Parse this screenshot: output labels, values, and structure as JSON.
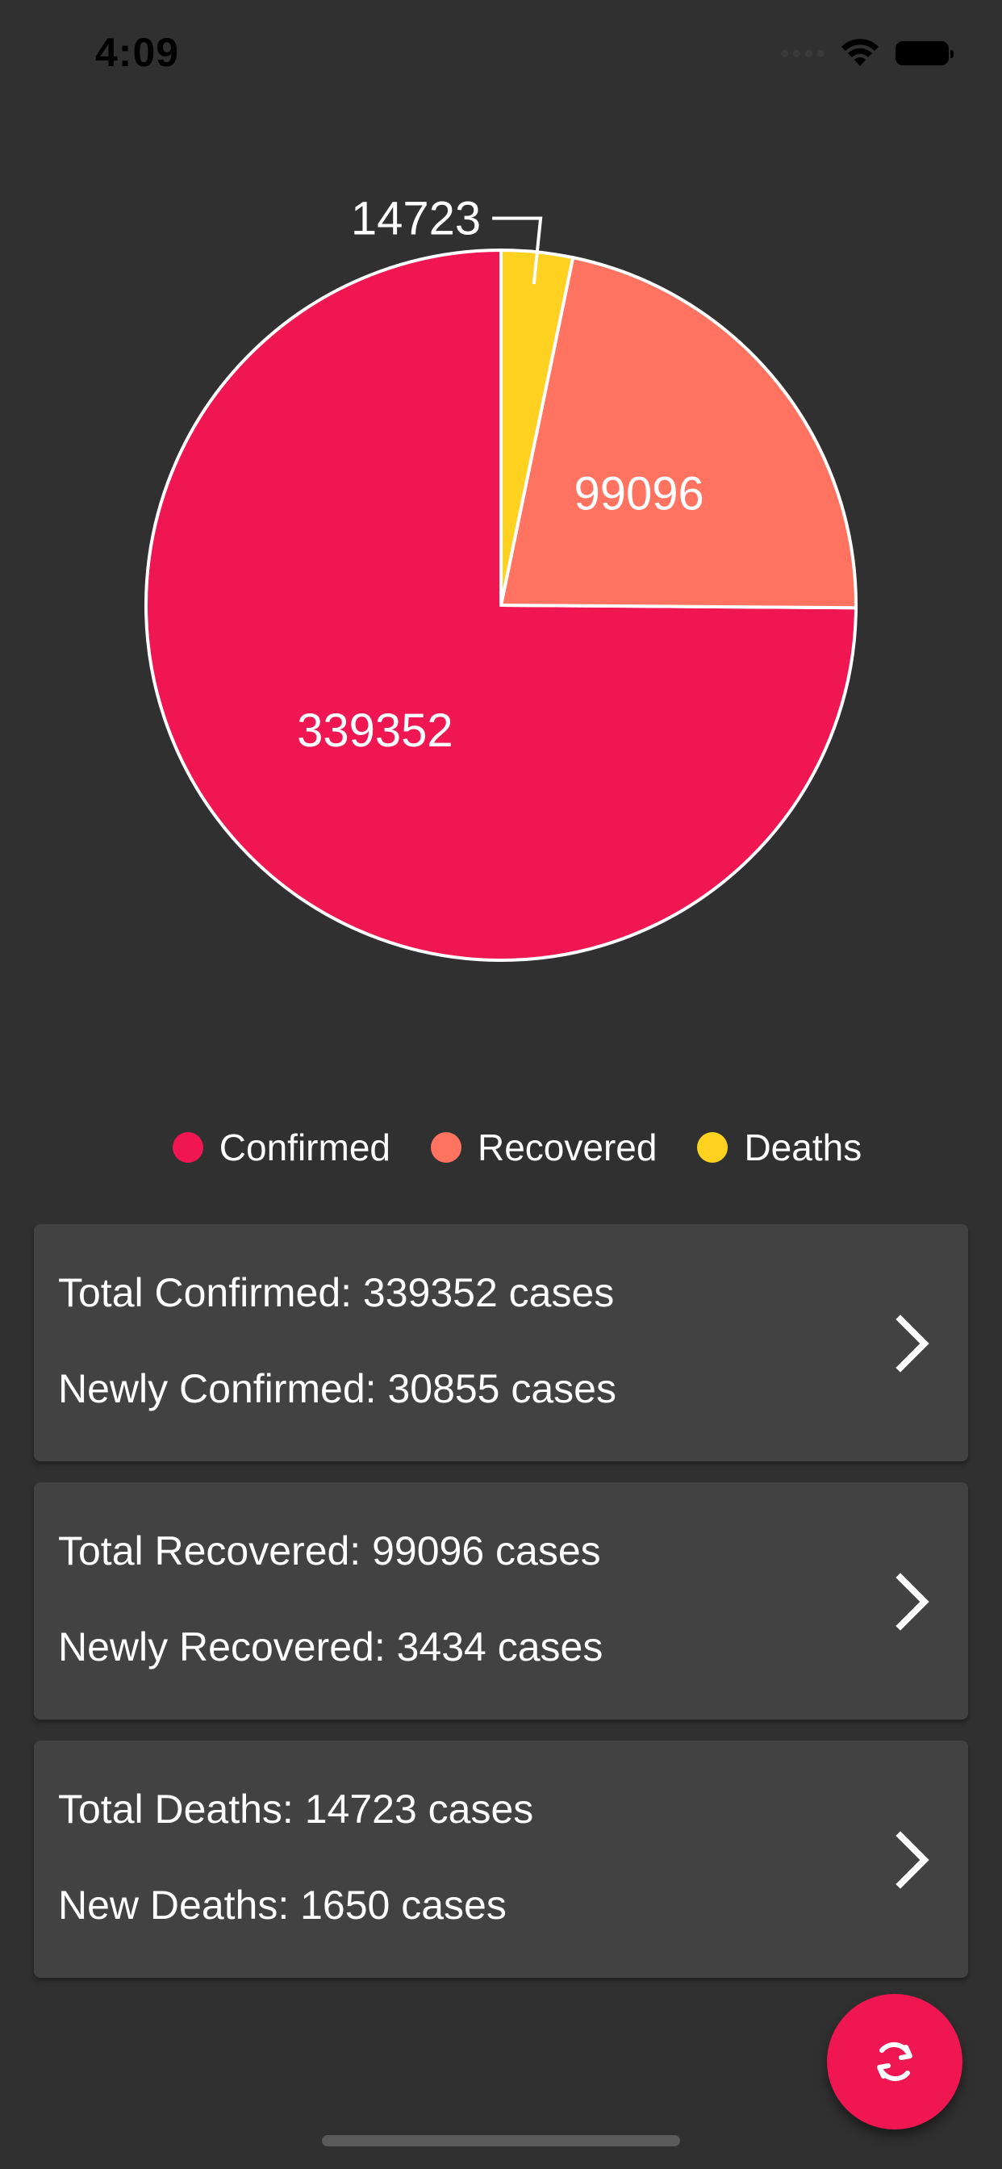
{
  "status_bar": {
    "time": "4:09",
    "icons": [
      "signal-icon",
      "wifi-icon",
      "battery-icon"
    ]
  },
  "chart_data": {
    "type": "pie",
    "categories": [
      "Confirmed",
      "Recovered",
      "Deaths"
    ],
    "values": [
      339352,
      99096,
      14723
    ],
    "colors": [
      "#f01651",
      "#ff7360",
      "#ffd221"
    ],
    "start_angle_deg": 0,
    "direction": "counterclockwise-from-top",
    "legend_position": "bottom-center"
  },
  "legend": [
    {
      "label": "Confirmed",
      "color": "#f01651"
    },
    {
      "label": "Recovered",
      "color": "#ff7360"
    },
    {
      "label": "Deaths",
      "color": "#ffd221"
    }
  ],
  "cards": [
    {
      "line1": "Total Confirmed: 339352 cases",
      "line2": "Newly Confirmed: 30855 cases"
    },
    {
      "line1": "Total Recovered: 99096 cases",
      "line2": "Newly Recovered: 3434 cases"
    },
    {
      "line1": "Total Deaths: 14723 cases",
      "line2": "New Deaths: 1650 cases"
    }
  ],
  "fab": {
    "icon": "refresh-icon",
    "color": "#f01651"
  },
  "colors": {
    "background": "#303030",
    "card": "#424242",
    "accent": "#f01651"
  }
}
